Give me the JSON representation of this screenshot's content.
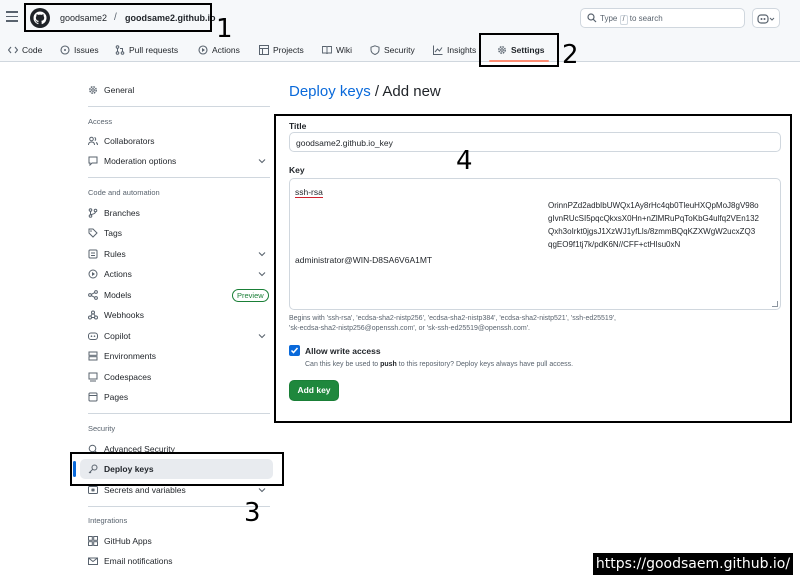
{
  "header": {
    "owner": "goodsame2",
    "separator": "/",
    "repo": "goodsame2.github.io",
    "search_prefix": "Type",
    "search_key": "/",
    "search_suffix": "to search"
  },
  "repo_tabs": [
    {
      "label": "Code",
      "icon": "code-icon"
    },
    {
      "label": "Issues",
      "icon": "issue-icon"
    },
    {
      "label": "Pull requests",
      "icon": "pull-request-icon"
    },
    {
      "label": "Actions",
      "icon": "play-icon"
    },
    {
      "label": "Projects",
      "icon": "table-icon"
    },
    {
      "label": "Wiki",
      "icon": "book-icon"
    },
    {
      "label": "Security",
      "icon": "shield-icon"
    },
    {
      "label": "Insights",
      "icon": "graph-icon"
    },
    {
      "label": "Settings",
      "icon": "gear-icon",
      "active": true
    }
  ],
  "sidebar": {
    "general": "General",
    "access_heading": "Access",
    "collaborators": "Collaborators",
    "moderation": "Moderation options",
    "code_heading": "Code and automation",
    "branches": "Branches",
    "tags": "Tags",
    "rules": "Rules",
    "actions": "Actions",
    "models": "Models",
    "preview_badge": "Preview",
    "webhooks": "Webhooks",
    "copilot": "Copilot",
    "environments": "Environments",
    "codespaces": "Codespaces",
    "pages": "Pages",
    "security_heading": "Security",
    "advanced_security": "Advanced Security",
    "deploy_keys": "Deploy keys",
    "secrets": "Secrets and variables",
    "integrations_heading": "Integrations",
    "github_apps": "GitHub Apps",
    "email_notifications": "Email notifications"
  },
  "main": {
    "breadcrumb": "Deploy keys",
    "breadcrumb_sep": " / ",
    "page_title": "Add new",
    "title_label": "Title",
    "title_value": "goodsame2.github.io_key",
    "key_label": "Key",
    "key_lines": [
      "ssh-rsa",
      "OrinnPZd2adbIbUWQx1Ay8rHc4qb0TleuHXQpMoJ8gV98o",
      "gIvnRUcSI5pqcQkxsX0Hn+nZlMRuPqToKbG4ulfq2VEn132",
      "Qxh3oIrkt0jgsJ1XzWJ1yfLls/8zmmBQqKZXWgW2ucxZQ3",
      "qgEO9f1tj7k/pdK6N//CFF+ctHIsu0xN",
      "administrator@WIN-D8SA6V6A1MT"
    ],
    "key_help_1": "Begins with 'ssh-rsa', 'ecdsa-sha2-nistp256', 'ecdsa-sha2-nistp384', 'ecdsa-sha2-nistp521', 'ssh-ed25519',",
    "key_help_2": "'sk-ecdsa-sha2-nistp256@openssh.com', or 'sk-ssh-ed25519@openssh.com'.",
    "allow_write_label": "Allow write access",
    "allow_write_checked": true,
    "allow_write_help_pre": "Can this key be used to ",
    "allow_write_help_bold": "push",
    "allow_write_help_post": " to this repository? Deploy keys always have pull access.",
    "add_button": "Add key"
  },
  "annotations": {
    "n1": "1",
    "n2": "2",
    "n3": "3",
    "n4": "4"
  },
  "watermark": "https://goodsaem.github.io/",
  "colors": {
    "accent": "#0969da",
    "primary_button": "#1f883d",
    "tab_underline": "#fd8c73"
  }
}
